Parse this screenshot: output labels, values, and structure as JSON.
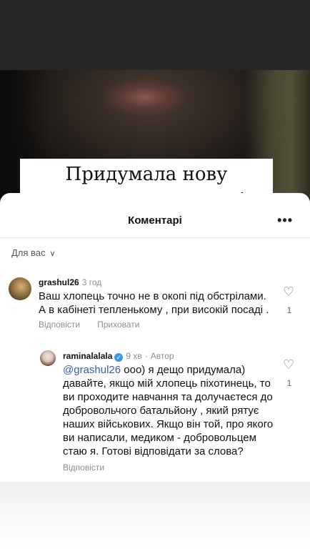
{
  "story": {
    "caption": "Придумала нову рекрутингову кампанію."
  },
  "comments_sheet": {
    "title": "Коментарі",
    "more_icon": "more-horizontal-icon",
    "filter_label": "Для вас",
    "comments": [
      {
        "username": "grashul26",
        "time": "3 год",
        "text": "Ваш хлопець точно не в окопі під обстрілами. А в кабінеті тепленькому , при високій посаді .",
        "reply_label": "Відповісти",
        "hide_label": "Приховати",
        "likes": "1"
      },
      {
        "username": "raminalalala",
        "verified": true,
        "time": "9 хв",
        "author_badge": "Автор",
        "mention": "@grashul26",
        "text": " ооо) я дещо придумала) давайте, якщо мій хлопець піхотинець, то ви проходите навчання та долучаєтеся до добровольчого батальйону , який рятує наших військових. Якщо він той, про якого ви написали, медиком - добровольцем стаю я. Готові відповідати за слова?",
        "reply_label": "Відповісти",
        "likes": "1"
      }
    ]
  },
  "colors": {
    "mention": "#3b5bb0",
    "verified": "#3897f0",
    "muted": "#8e8e8e"
  }
}
